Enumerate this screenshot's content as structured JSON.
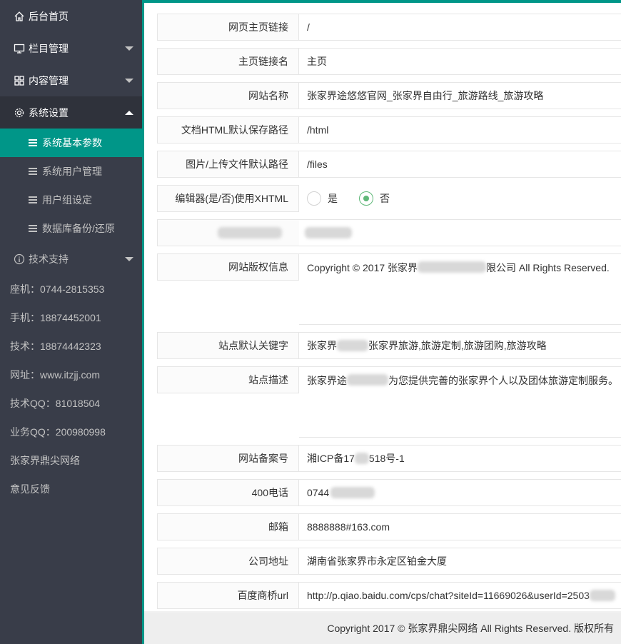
{
  "sidebar": {
    "home": "后台首页",
    "column": "栏目管理",
    "content": "内容管理",
    "system": "系统设置",
    "sub_items": [
      "系统基本参数",
      "系统用户管理",
      "用户组设定",
      "数据库备份/还原"
    ],
    "support": "技术支持",
    "info": [
      "座机：0744-2815353",
      "手机：18874452001",
      "技术：18874442323",
      "网址：www.itzjj.com",
      "技术QQ：81018504",
      "业务QQ：200980998",
      "张家界鼎尖网络",
      "意见反馈"
    ]
  },
  "form": {
    "homepage_url_label": "网页主页链接",
    "homepage_url_value": "/",
    "homepage_name_label": "主页链接名",
    "homepage_name_value": "主页",
    "site_name_label": "网站名称",
    "site_name_value": "张家界途悠悠官网_张家界自由行_旅游路线_旅游攻略",
    "html_path_label": "文档HTML默认保存路径",
    "html_path_value": "/html",
    "upload_path_label": "图片/上传文件默认路径",
    "upload_path_value": "/files",
    "xhtml_label": "编辑器(是/否)使用XHTML",
    "xhtml_yes": "是",
    "xhtml_no": "否",
    "copyright_label": "网站版权信息",
    "copyright_value_a": "Copyright © 2017 张家界",
    "copyright_value_b": "限公司 All Rights Reserved.",
    "keywords_label": "站点默认关键字",
    "keywords_value_a": "张家界",
    "keywords_value_b": "张家界旅游,旅游定制,旅游团购,旅游攻略",
    "desc_label": "站点描述",
    "desc_value_a": "张家界途",
    "desc_value_b": "为您提供完善的张家界个人以及团体旅游定制服务。",
    "icp_label": "网站备案号",
    "icp_value_a": "湘ICP备17",
    "icp_value_b": "518号-1",
    "phone_label": "400电话",
    "phone_value": "0744",
    "email_label": "邮箱",
    "email_value": "8888888#163.com",
    "address_label": "公司地址",
    "address_value": "湖南省张家界市永定区铂金大厦",
    "baidu_label": "百度商桥url",
    "baidu_value": "http://p.qiao.baidu.com/cps/chat?siteId=11669026&userId=2503"
  },
  "footer": "Copyright 2017 © 张家界鼎尖网络 All Rights Reserved. 版权所有",
  "colors": {
    "sidebar": "#393d49",
    "accent": "#009688",
    "radio": "#5fb878"
  }
}
